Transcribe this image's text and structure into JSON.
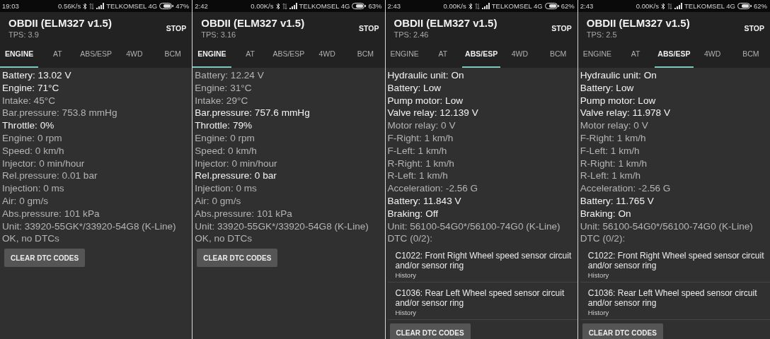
{
  "screens": [
    {
      "status_bar": {
        "time": "19:03",
        "net_speed": "0.56K/s",
        "carrier": "TELKOMSEL 4G",
        "battery": "47%"
      },
      "app_bar": {
        "title": "OBDII (ELM327 v1.5)",
        "subtitle": "TPS: 3.9",
        "action": "STOP"
      },
      "tabs": [
        {
          "label": "ENGINE",
          "selected": true
        },
        {
          "label": "AT",
          "selected": false
        },
        {
          "label": "ABS/ESP",
          "selected": false
        },
        {
          "label": "4WD",
          "selected": false
        },
        {
          "label": "BCM",
          "selected": false
        }
      ],
      "readings": [
        {
          "text": "Battery: 13.02 V",
          "highlighted": true
        },
        {
          "text": "Engine: 71°C",
          "highlighted": true
        },
        {
          "text": "Intake: 45°C",
          "highlighted": false
        },
        {
          "text": "Bar.pressure: 753.8 mmHg",
          "highlighted": false
        },
        {
          "text": "Throttle: 0%",
          "highlighted": true
        },
        {
          "text": "Engine: 0 rpm",
          "highlighted": false
        },
        {
          "text": "Speed: 0 km/h",
          "highlighted": false
        },
        {
          "text": "Injector: 0 min/hour",
          "highlighted": false
        },
        {
          "text": "Rel.pressure: 0.01 bar",
          "highlighted": false
        },
        {
          "text": "Injection: 0 ms",
          "highlighted": false
        },
        {
          "text": "Air: 0 gm/s",
          "highlighted": false
        },
        {
          "text": "Abs.pressure: 101 kPa",
          "highlighted": false
        },
        {
          "text": "Unit: 33920-55GK*/33920-54G8 (K-Line)",
          "highlighted": false
        },
        {
          "text": "OK, no DTCs",
          "highlighted": false
        }
      ],
      "button": "CLEAR DTC CODES"
    },
    {
      "status_bar": {
        "time": "2:42",
        "net_speed": "0.00K/s",
        "carrier": "TELKOMSEL 4G",
        "battery": "63%"
      },
      "app_bar": {
        "title": "OBDII (ELM327 v1.5)",
        "subtitle": "TPS: 3.16",
        "action": "STOP"
      },
      "tabs": [
        {
          "label": "ENGINE",
          "selected": true
        },
        {
          "label": "AT",
          "selected": false
        },
        {
          "label": "ABS/ESP",
          "selected": false
        },
        {
          "label": "4WD",
          "selected": false
        },
        {
          "label": "BCM",
          "selected": false
        }
      ],
      "readings": [
        {
          "text": "Battery: 12.24 V",
          "highlighted": false
        },
        {
          "text": "Engine: 31°C",
          "highlighted": false
        },
        {
          "text": "Intake: 29°C",
          "highlighted": false
        },
        {
          "text": "Bar.pressure: 757.6 mmHg",
          "highlighted": true
        },
        {
          "text": "Throttle: 79%",
          "highlighted": true
        },
        {
          "text": "Engine: 0 rpm",
          "highlighted": false
        },
        {
          "text": "Speed: 0 km/h",
          "highlighted": false
        },
        {
          "text": "Injector: 0 min/hour",
          "highlighted": false
        },
        {
          "text": "Rel.pressure: 0 bar",
          "highlighted": true
        },
        {
          "text": "Injection: 0 ms",
          "highlighted": false
        },
        {
          "text": "Air: 0 gm/s",
          "highlighted": false
        },
        {
          "text": "Abs.pressure: 101 kPa",
          "highlighted": false
        },
        {
          "text": "Unit: 33920-55GK*/33920-54G8 (K-Line)",
          "highlighted": false
        },
        {
          "text": "OK, no DTCs",
          "highlighted": false
        }
      ],
      "button": "CLEAR DTC CODES"
    },
    {
      "status_bar": {
        "time": "2:43",
        "net_speed": "0.00K/s",
        "carrier": "TELKOMSEL 4G",
        "battery": "62%"
      },
      "app_bar": {
        "title": "OBDII (ELM327 v1.5)",
        "subtitle": "TPS: 2.46",
        "action": "STOP"
      },
      "tabs": [
        {
          "label": "ENGINE",
          "selected": false
        },
        {
          "label": "AT",
          "selected": false
        },
        {
          "label": "ABS/ESP",
          "selected": true
        },
        {
          "label": "4WD",
          "selected": false
        },
        {
          "label": "BCM",
          "selected": false
        }
      ],
      "readings": [
        {
          "text": "Hydraulic unit: On",
          "highlighted": true
        },
        {
          "text": "Battery: Low",
          "highlighted": true
        },
        {
          "text": "Pump motor: Low",
          "highlighted": true
        },
        {
          "text": "Valve relay: 12.139 V",
          "highlighted": true
        },
        {
          "text": "Motor relay: 0 V",
          "highlighted": false
        },
        {
          "text": "F-Right: 1 km/h",
          "highlighted": false
        },
        {
          "text": "F-Left: 1 km/h",
          "highlighted": false
        },
        {
          "text": "R-Right: 1 km/h",
          "highlighted": false
        },
        {
          "text": "R-Left: 1 km/h",
          "highlighted": false
        },
        {
          "text": "Acceleration: -2.56 G",
          "highlighted": false
        },
        {
          "text": "Battery: 11.843 V",
          "highlighted": true
        },
        {
          "text": "Braking: Off",
          "highlighted": true
        },
        {
          "text": "Unit: 56100-54G0*/56100-74G0 (K-Line)",
          "highlighted": false
        },
        {
          "text": "DTC (0/2):",
          "highlighted": false
        }
      ],
      "dtcs": [
        {
          "description": "C1022: Front Right Wheel speed sensor circuit and/or sensor ring",
          "status": "History"
        },
        {
          "description": "C1036: Rear Left Wheel speed sensor circuit and/or sensor ring",
          "status": "History"
        }
      ],
      "button": "CLEAR DTC CODES"
    },
    {
      "status_bar": {
        "time": "2:43",
        "net_speed": "0.00K/s",
        "carrier": "TELKOMSEL 4G",
        "battery": "62%"
      },
      "app_bar": {
        "title": "OBDII (ELM327 v1.5)",
        "subtitle": "TPS: 2.5",
        "action": "STOP"
      },
      "tabs": [
        {
          "label": "ENGINE",
          "selected": false
        },
        {
          "label": "AT",
          "selected": false
        },
        {
          "label": "ABS/ESP",
          "selected": true
        },
        {
          "label": "4WD",
          "selected": false
        },
        {
          "label": "BCM",
          "selected": false
        }
      ],
      "readings": [
        {
          "text": "Hydraulic unit: On",
          "highlighted": true
        },
        {
          "text": "Battery: Low",
          "highlighted": true
        },
        {
          "text": "Pump motor: Low",
          "highlighted": true
        },
        {
          "text": "Valve relay: 11.978 V",
          "highlighted": true
        },
        {
          "text": "Motor relay: 0 V",
          "highlighted": false
        },
        {
          "text": "F-Right: 1 km/h",
          "highlighted": false
        },
        {
          "text": "F-Left: 1 km/h",
          "highlighted": false
        },
        {
          "text": "R-Right: 1 km/h",
          "highlighted": false
        },
        {
          "text": "R-Left: 1 km/h",
          "highlighted": false
        },
        {
          "text": "Acceleration: -2.56 G",
          "highlighted": false
        },
        {
          "text": "Battery: 11.765 V",
          "highlighted": true
        },
        {
          "text": "Braking: On",
          "highlighted": true
        },
        {
          "text": "Unit: 56100-54G0*/56100-74G0 (K-Line)",
          "highlighted": false
        },
        {
          "text": "DTC (0/2):",
          "highlighted": false
        }
      ],
      "dtcs": [
        {
          "description": "C1022: Front Right Wheel speed sensor circuit and/or sensor ring",
          "status": "History"
        },
        {
          "description": "C1036: Rear Left Wheel speed sensor circuit and/or sensor ring",
          "status": "History"
        }
      ],
      "button": "CLEAR DTC CODES"
    }
  ]
}
